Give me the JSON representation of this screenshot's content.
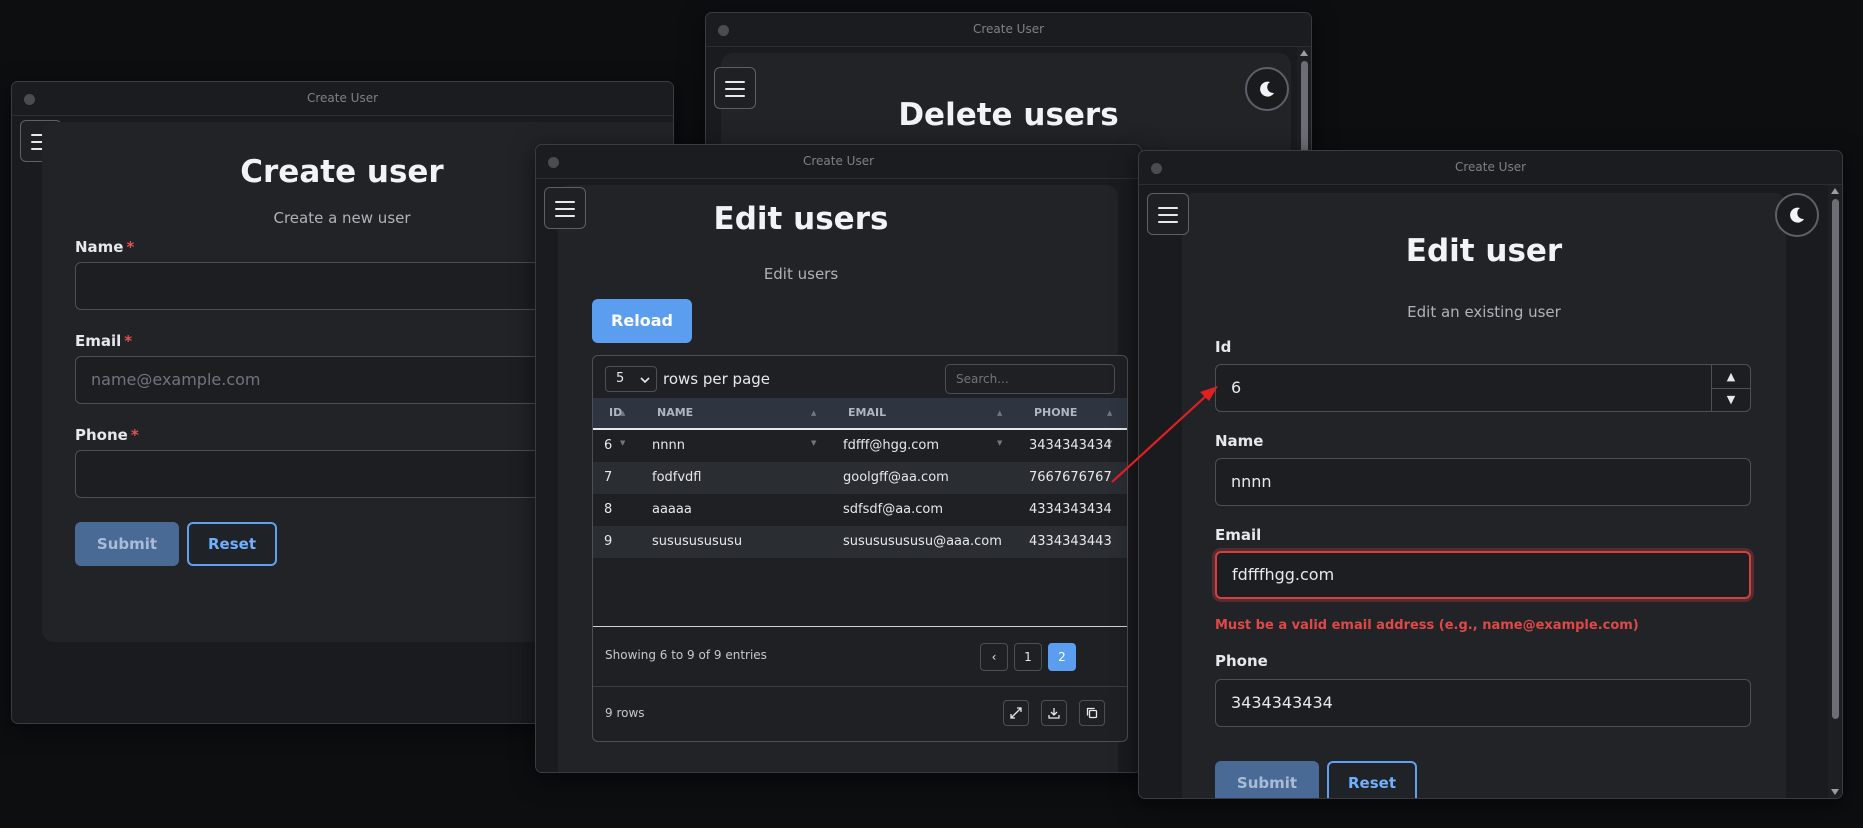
{
  "windows": {
    "create_window": {
      "title": "Create User",
      "heading": "Create user",
      "subtitle": "Create a new user",
      "fields": {
        "name_label": "Name",
        "email_label": "Email",
        "email_placeholder": "name@example.com",
        "phone_label": "Phone",
        "required_mark": "*"
      },
      "submit_label": "Submit",
      "reset_label": "Reset"
    },
    "delete_window": {
      "title": "Create User",
      "heading": "Delete users"
    },
    "edit_users_window": {
      "title": "Create User",
      "heading": "Edit users",
      "subtitle": "Edit users",
      "reload_label": "Reload",
      "table": {
        "rows_per_page_value": "5",
        "rows_per_page_label": "rows per page",
        "search_placeholder": "Search...",
        "columns": [
          "ID",
          "NAME",
          "EMAIL",
          "PHONE"
        ],
        "rows": [
          {
            "id": "6",
            "name": "nnnn",
            "email": "fdfff@hgg.com",
            "phone": "3434343434"
          },
          {
            "id": "7",
            "name": "fodfvdfl",
            "email": "goolgff@aa.com",
            "phone": "7667676767"
          },
          {
            "id": "8",
            "name": "aaaaa",
            "email": "sdfsdf@aa.com",
            "phone": "4334343434"
          },
          {
            "id": "9",
            "name": "susususususu",
            "email": "susususususu@aaa.com",
            "phone": "4334343443"
          }
        ],
        "showing_text": "Showing 6 to 9 of 9 entries",
        "pagination": {
          "prev": "‹",
          "pages": [
            "1",
            "2"
          ],
          "current": "2"
        },
        "row_count": "9 rows"
      }
    },
    "edit_user_window": {
      "title": "Create User",
      "heading": "Edit user",
      "subtitle": "Edit an existing user",
      "fields": {
        "id_label": "Id",
        "id_value": "6",
        "name_label": "Name",
        "name_value": "nnnn",
        "email_label": "Email",
        "email_value": "fdfffhgg.com",
        "email_error": "Must be a valid email address (e.g., name@example.com)",
        "phone_label": "Phone",
        "phone_value": "3434343434"
      },
      "submit_label": "Submit",
      "reset_label": "Reset"
    }
  },
  "icons": {
    "menu": "hamburger-icon",
    "theme": "moon-icon",
    "expand": "expand-icon",
    "download": "download-icon",
    "copy": "copy-icon",
    "annotation": "red-arrow"
  },
  "colors": {
    "background": "#0d0e10",
    "accent": "#5b9ef0",
    "error": "#e04848",
    "annotation_arrow": "#e02020"
  }
}
